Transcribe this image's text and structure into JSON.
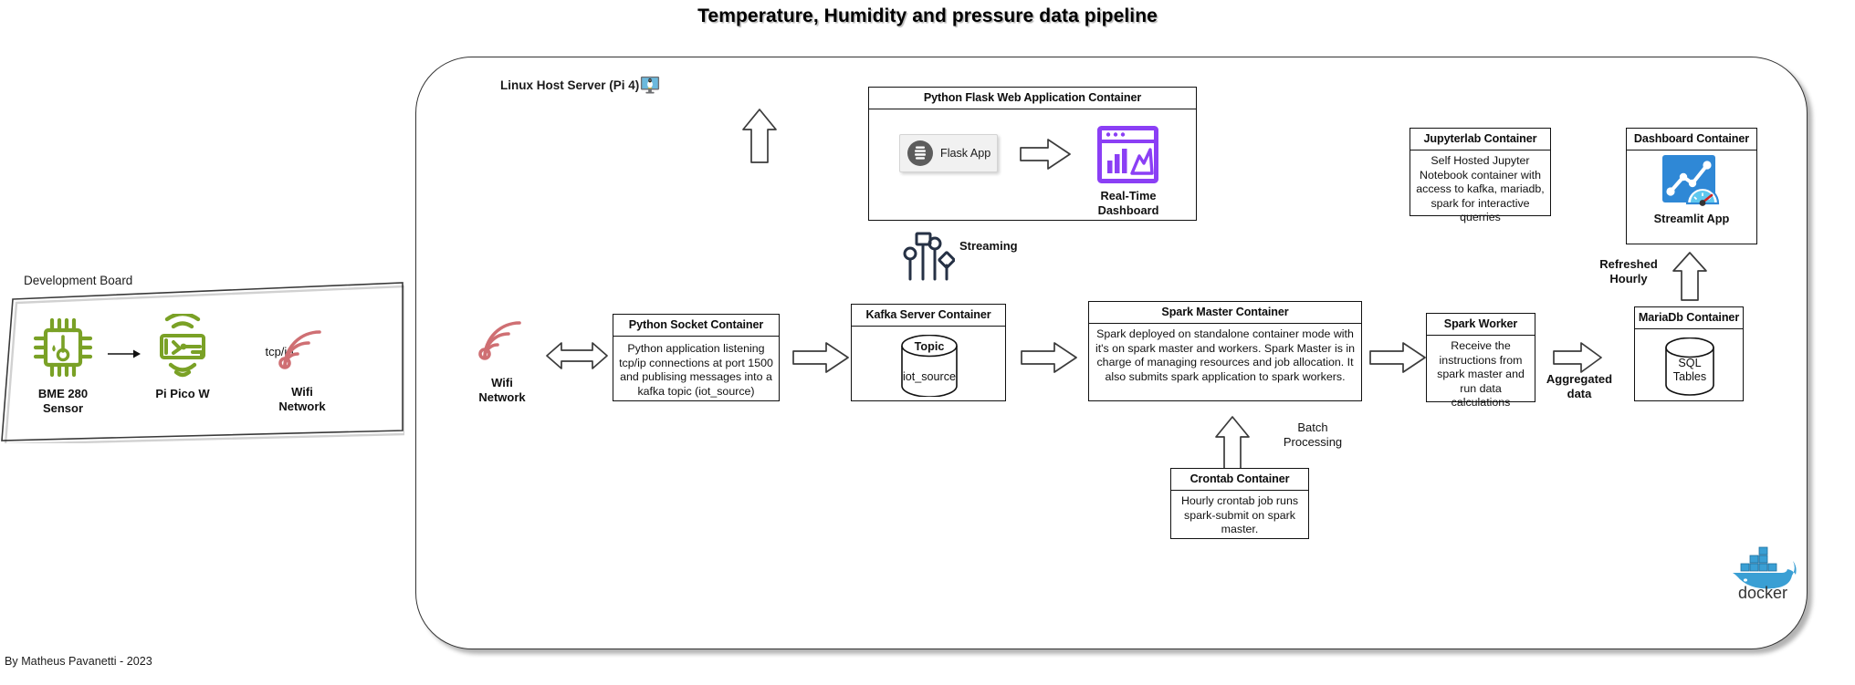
{
  "title": "Temperature, Humidity and pressure data pipeline",
  "footer": "By Matheus Pavanetti - 2023",
  "host_server": {
    "label": "Linux Host Server (Pi 4)",
    "icon": "linux-monitor-icon"
  },
  "dev_board": {
    "label": "Development Board",
    "nodes": [
      {
        "name": "sensor",
        "label_line1": "BME 280",
        "label_line2": "Sensor",
        "icon": "temperature-sensor-chip-icon",
        "color": "#7aa126"
      },
      {
        "name": "microcontroller",
        "label_line1": "Pi Pico W",
        "label_line2": "",
        "icon": "pi-pico-w-board-icon",
        "color": "#7aa126"
      },
      {
        "name": "wifi",
        "label_line1": "Wifi",
        "label_line2": "Network",
        "icon": "wifi-icon",
        "color": "#cf6f73"
      }
    ],
    "link_label": "tcp/ip"
  },
  "wifi_network_node": {
    "label_line1": "Wifi",
    "label_line2": "Network",
    "icon": "wifi-icon",
    "color": "#cf6f73"
  },
  "containers": {
    "flask": {
      "title": "Python Flask Web Application Container",
      "app_button_label": "Flask App",
      "app_button_icon": "flask-app-icon",
      "dashboard_icon": "realtime-dashboard-icon",
      "dashboard_caption_line1": "Real-Time",
      "dashboard_caption_line2": "Dashboard",
      "accent_color": "#8b3ff5"
    },
    "python_socket": {
      "title": "Python Socket Container",
      "body": "Python application listening tcp/ip connections at port 1500 and publising messages into a kafka topic (iot_source)"
    },
    "kafka": {
      "title": "Kafka Server Container",
      "topic_label": "Topic",
      "topic_name": "iot_source"
    },
    "spark_master": {
      "title": "Spark Master Container",
      "body": "Spark deployed on standalone container mode with it's on spark master and workers. Spark Master is in charge of managing resources and job allocation. It also submits spark application to spark workers."
    },
    "spark_worker": {
      "title": "Spark Worker",
      "body": "Receive the instructions from spark master and run data calculations"
    },
    "mariadb": {
      "title": "MariaDb Container",
      "table_label_line1": "SQL",
      "table_label_line2": "Tables"
    },
    "crontab": {
      "title": "Crontab Container",
      "body": "Hourly crontab job runs spark-submit on spark master."
    },
    "jupyterlab": {
      "title": "Jupyterlab Container",
      "body": "Self Hosted Jupyter Notebook container with access to kafka, mariadb, spark for interactive querries"
    },
    "dashboard": {
      "title": "Dashboard Container",
      "app_caption": "Streamlit App",
      "app_icon": "streamlit-app-icon",
      "accent_color": "#2f88d6"
    }
  },
  "flow_labels": {
    "streaming": "Streaming",
    "batch_line1": "Batch",
    "batch_line2": "Processing",
    "aggregated_line1": "Aggregated",
    "aggregated_line2": "data",
    "refreshed_line1": "Refreshed",
    "refreshed_line2": "Hourly"
  },
  "branding": {
    "docker_label": "docker",
    "docker_icon": "docker-whale-icon"
  }
}
